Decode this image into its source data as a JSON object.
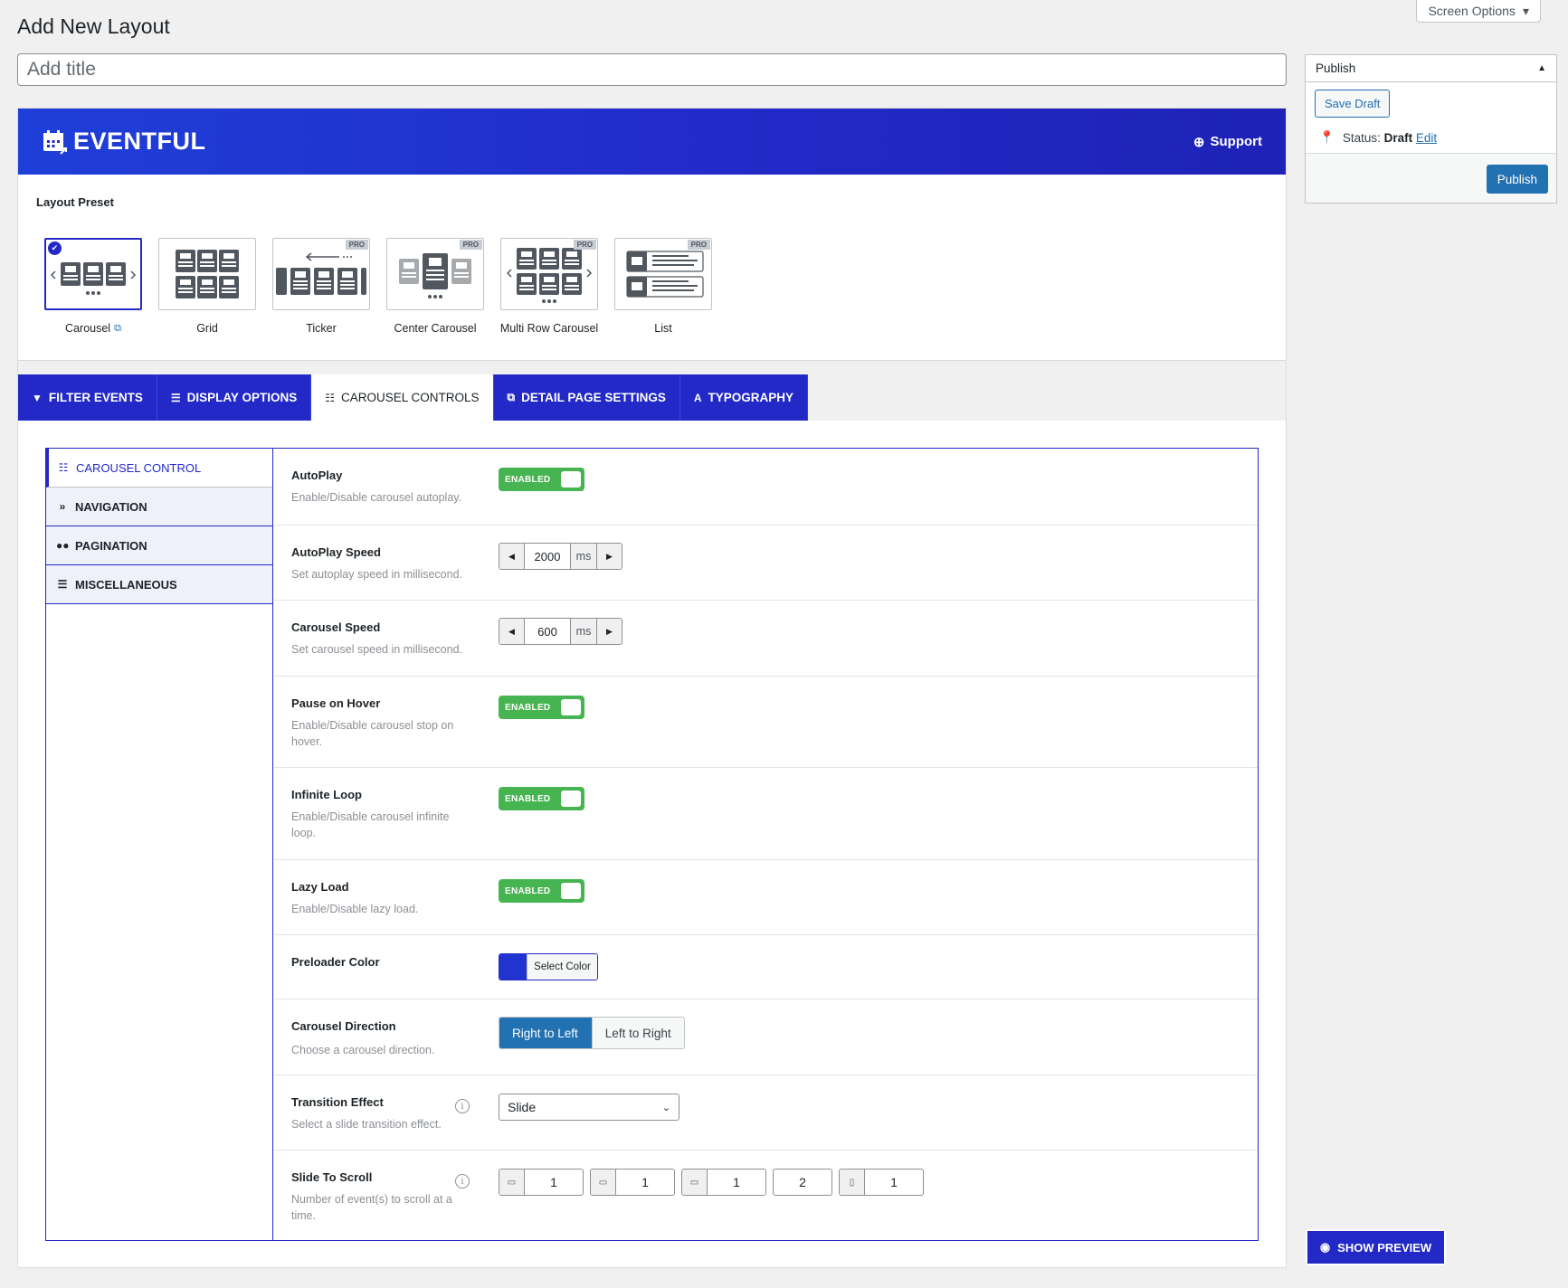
{
  "screen_options": "Screen Options",
  "page_title": "Add New Layout",
  "title_placeholder": "Add title",
  "banner": {
    "brand": "EVENTFUL",
    "support": "Support"
  },
  "layout_preset": {
    "label": "Layout Preset",
    "items": [
      {
        "label": "Carousel",
        "selected": true,
        "pro": false
      },
      {
        "label": "Grid",
        "selected": false,
        "pro": false
      },
      {
        "label": "Ticker",
        "selected": false,
        "pro": true
      },
      {
        "label": "Center Carousel",
        "selected": false,
        "pro": true
      },
      {
        "label": "Multi Row Carousel",
        "selected": false,
        "pro": true
      },
      {
        "label": "List",
        "selected": false,
        "pro": true
      }
    ],
    "pro_badge": "PRO"
  },
  "tabs": [
    {
      "label": "FILTER EVENTS",
      "icon": "filter-icon"
    },
    {
      "label": "DISPLAY OPTIONS",
      "icon": "list-icon"
    },
    {
      "label": "CAROUSEL CONTROLS",
      "icon": "sliders-icon",
      "active": true
    },
    {
      "label": "DETAIL PAGE SETTINGS",
      "icon": "external-link-icon"
    },
    {
      "label": "TYPOGRAPHY",
      "icon": "font-icon"
    }
  ],
  "subnav": [
    {
      "label": "CAROUSEL CONTROL",
      "icon": "sliders-icon",
      "active": true
    },
    {
      "label": "NAVIGATION",
      "icon": "chevrons-right-icon"
    },
    {
      "label": "PAGINATION",
      "icon": "dots-icon"
    },
    {
      "label": "MISCELLANEOUS",
      "icon": "list-icon"
    }
  ],
  "fields": {
    "autoplay": {
      "title": "AutoPlay",
      "desc": "Enable/Disable carousel autoplay.",
      "toggle": "ENABLED"
    },
    "autoplay_speed": {
      "title": "AutoPlay Speed",
      "desc": "Set autoplay speed in millisecond.",
      "value": "2000",
      "unit": "ms"
    },
    "carousel_speed": {
      "title": "Carousel Speed",
      "desc": "Set carousel speed in millisecond.",
      "value": "600",
      "unit": "ms"
    },
    "pause_hover": {
      "title": "Pause on Hover",
      "desc": "Enable/Disable carousel stop on hover.",
      "toggle": "ENABLED"
    },
    "infinite_loop": {
      "title": "Infinite Loop",
      "desc": "Enable/Disable carousel infinite loop.",
      "toggle": "ENABLED"
    },
    "lazy_load": {
      "title": "Lazy Load",
      "desc": "Enable/Disable lazy load.",
      "toggle": "ENABLED"
    },
    "preloader_color": {
      "title": "Preloader Color",
      "button": "Select Color",
      "color": "#2234d0"
    },
    "direction": {
      "title": "Carousel Direction",
      "desc": "Choose a carousel direction.",
      "options": [
        "Right to Left",
        "Left to Right"
      ],
      "selected": "Right to Left"
    },
    "transition": {
      "title": "Transition Effect",
      "desc": "Select a slide transition effect.",
      "value": "Slide"
    },
    "slide_scroll": {
      "title": "Slide To Scroll",
      "desc": "Number of event(s) to scroll at a time.",
      "values": [
        "1",
        "1",
        "1",
        "2",
        "1"
      ]
    }
  },
  "publish": {
    "heading": "Publish",
    "save_draft": "Save Draft",
    "status_label": "Status:",
    "status_value": "Draft",
    "edit": "Edit",
    "publish_button": "Publish"
  },
  "show_preview": "SHOW PREVIEW",
  "colors": {
    "brand_blue": "#2229c6",
    "wp_blue": "#2271b1",
    "toggle_green": "#46b450"
  }
}
